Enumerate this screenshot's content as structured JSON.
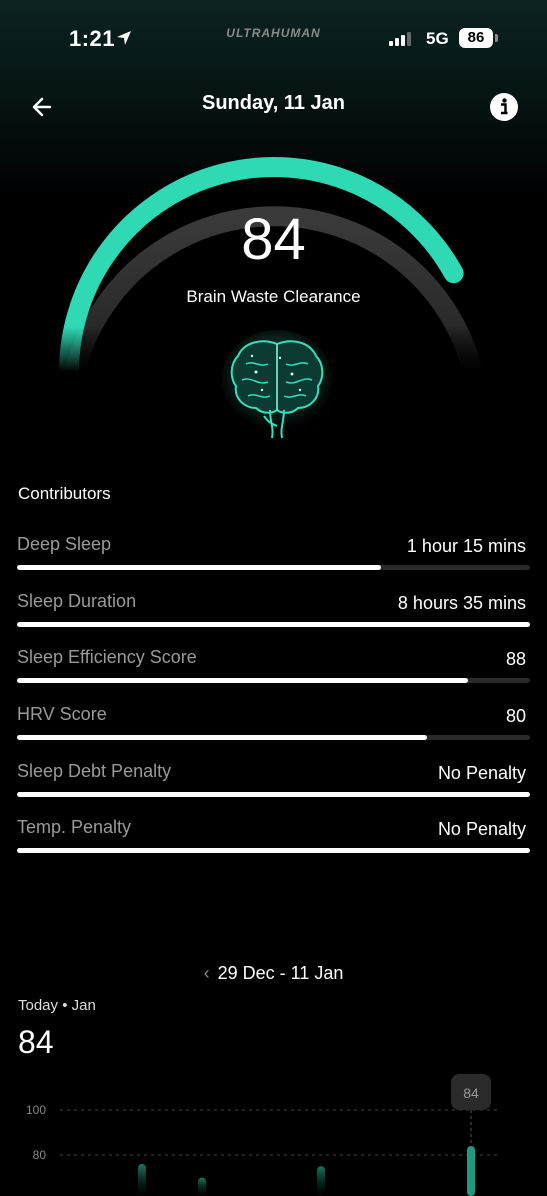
{
  "status_bar": {
    "time": "1:21",
    "brand": "ULTRAHUMAN",
    "network": "5G",
    "battery": "86"
  },
  "header": {
    "title": "Sunday, 11 Jan",
    "back_icon": "arrow-left-icon",
    "info_icon": "info-icon"
  },
  "gauge": {
    "score": "84",
    "label": "Brain Waste Clearance",
    "progress": 0.84,
    "accent": "#2fd9b4"
  },
  "contributors": {
    "title": "Contributors",
    "items": [
      {
        "label": "Deep Sleep",
        "value": "1 hour 15 mins",
        "progress": 0.71
      },
      {
        "label": "Sleep Duration",
        "value": "8 hours 35 mins",
        "progress": 1.0
      },
      {
        "label": "Sleep Efficiency Score",
        "value": "88",
        "progress": 0.88
      },
      {
        "label": "HRV Score",
        "value": "80",
        "progress": 0.8
      },
      {
        "label": "Sleep Debt Penalty",
        "value": "No Penalty",
        "progress": 1.0
      },
      {
        "label": "Temp. Penalty",
        "value": "No Penalty",
        "progress": 1.0
      }
    ]
  },
  "history": {
    "range": "29 Dec - 11 Jan",
    "today_label": "Today",
    "month": "Jan",
    "today_score": "84",
    "tooltip": "84"
  },
  "chart_data": {
    "type": "bar",
    "y_ticks": [
      "100",
      "80"
    ],
    "values": [
      76,
      70,
      75,
      84
    ],
    "ylim": [
      60,
      100
    ]
  }
}
